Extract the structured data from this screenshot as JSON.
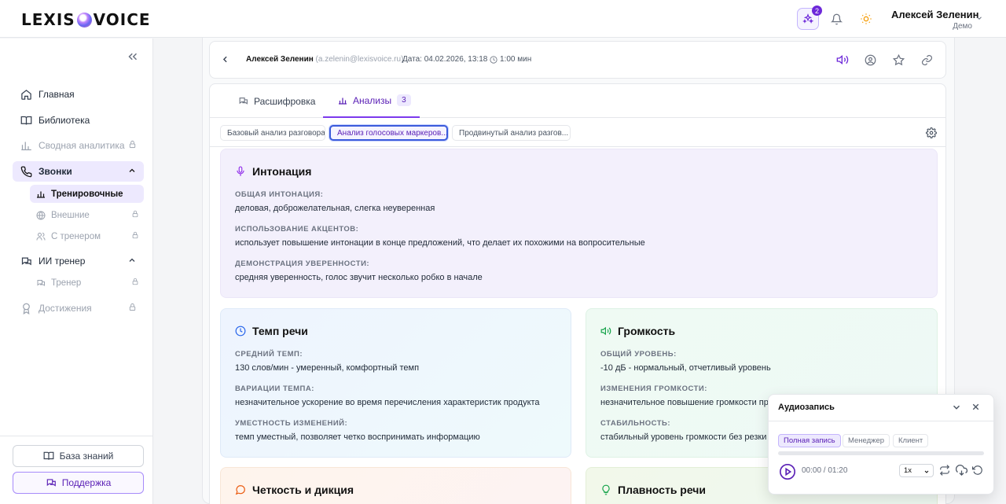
{
  "brand": {
    "logo_left": "LEXIS",
    "logo_right": "VOICE"
  },
  "topbar": {
    "notif_count": "2",
    "user_name": "Алексей Зеленин",
    "user_role": "Демо"
  },
  "sidebar": {
    "items": [
      {
        "label": "Главная",
        "icon": "home-icon"
      },
      {
        "label": "Библиотека",
        "icon": "book-icon"
      },
      {
        "label": "Сводная аналитика",
        "icon": "chart-icon",
        "locked": true
      },
      {
        "label": "Звонки",
        "icon": "phone-icon",
        "expanded": true
      },
      {
        "label": "ИИ тренер",
        "icon": "chat-icon",
        "expanded": true
      },
      {
        "label": "Достижения",
        "icon": "award-icon",
        "locked": true
      }
    ],
    "calls_sub": [
      {
        "label": "Тренировочные"
      },
      {
        "label": "Внешние",
        "locked": true
      },
      {
        "label": "С тренером",
        "locked": true
      }
    ],
    "coach_sub": [
      {
        "label": "Тренер",
        "locked": true
      }
    ],
    "knowledge_base": "База знаний",
    "support": "Поддержка"
  },
  "call": {
    "name": "Алексей Зеленин",
    "email": "(a.zelenin@lexisvoice.ru)",
    "date": "Дата: 04.02.2026, 13:18",
    "duration": "1:00 мин"
  },
  "tabs": [
    {
      "label": "Расшифровка"
    },
    {
      "label": "Анализы",
      "count": "3"
    }
  ],
  "subtabs": [
    "Базовый анализ разговора",
    "Анализ голосовых маркеров...",
    "Продвинутый анализ разгов..."
  ],
  "panels": {
    "intonation": {
      "title": "Интонация",
      "fields": [
        {
          "label": "Общая интонация:",
          "value": "деловая, доброжелательная, слегка неуверенная"
        },
        {
          "label": "Использование акцентов:",
          "value": "использует повышение интонации в конце предложений, что делает их похожими на вопросительные"
        },
        {
          "label": "Демонстрация уверенности:",
          "value": "средняя уверенность, голос звучит несколько робко в начале"
        }
      ]
    },
    "tempo": {
      "title": "Темп речи",
      "fields": [
        {
          "label": "Средний темп:",
          "value": "130 слов/мин - умеренный, комфортный темп"
        },
        {
          "label": "Вариации темпа:",
          "value": "незначительное ускорение во время перечисления характеристик продукта"
        },
        {
          "label": "Уместность изменений:",
          "value": "темп уместный, позволяет четко воспринимать информацию"
        }
      ]
    },
    "volume": {
      "title": "Громкость",
      "fields": [
        {
          "label": "Общий уровень:",
          "value": "-10 дБ - нормальный, отчетливый уровень"
        },
        {
          "label": "Изменения громкости:",
          "value": "незначительное повышение громкости пр"
        },
        {
          "label": "Стабильность:",
          "value": "стабильный уровень громкости без резки"
        }
      ]
    },
    "clarity": {
      "title": "Четкость и дикция"
    },
    "fluency": {
      "title": "Плавность речи"
    }
  },
  "audio": {
    "title": "Аудиозапись",
    "chips": [
      "Полная запись",
      "Менеджер",
      "Клиент"
    ],
    "time": "00:00 / 01:20",
    "progress": 0,
    "speed": "1x"
  },
  "colors": {
    "accent": "#7c3aed",
    "accent_light": "#ede9fe"
  }
}
